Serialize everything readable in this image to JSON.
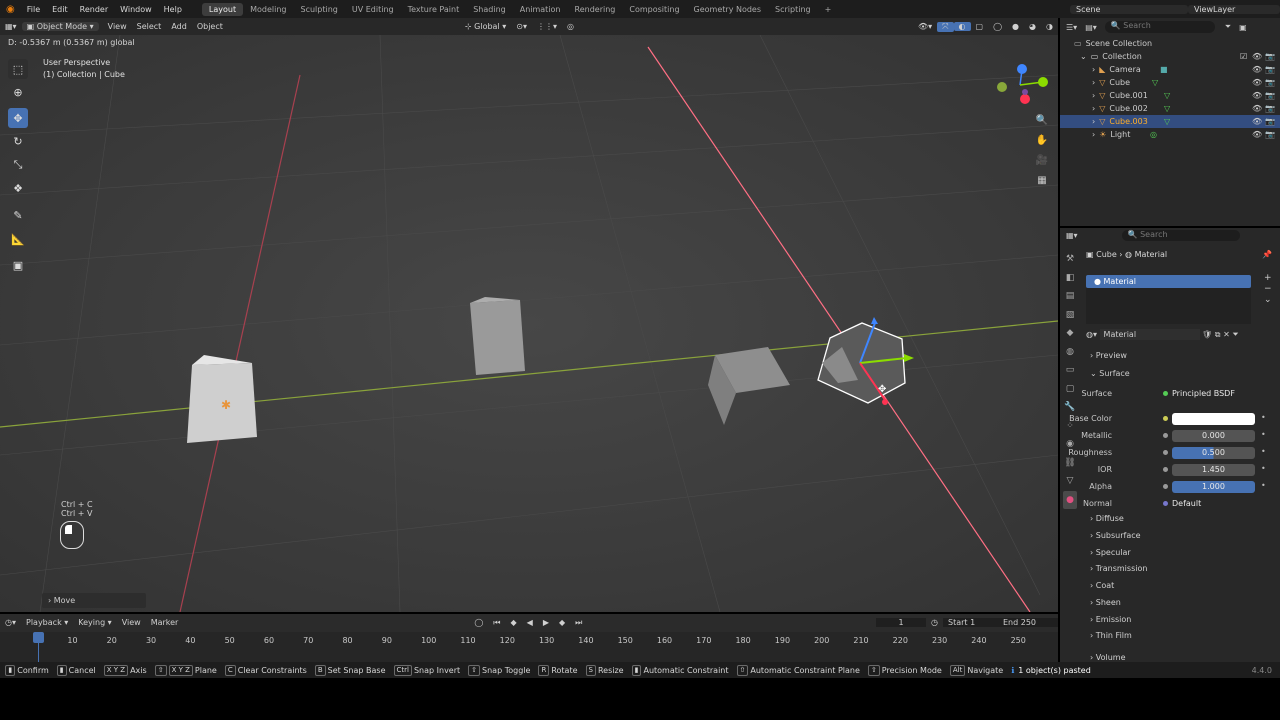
{
  "topbar": {
    "menus": [
      "File",
      "Edit",
      "Render",
      "Window",
      "Help"
    ],
    "workspaces": [
      "Layout",
      "Modeling",
      "Sculpting",
      "UV Editing",
      "Texture Paint",
      "Shading",
      "Animation",
      "Rendering",
      "Compositing",
      "Geometry Nodes",
      "Scripting"
    ],
    "scene": "Scene",
    "view_layer": "ViewLayer"
  },
  "vpheader": {
    "mode": "Object Mode",
    "menus": [
      "View",
      "Select",
      "Add",
      "Object"
    ],
    "orientation": "Global"
  },
  "viewport": {
    "status": "D: -0.5367 m (0.5367 m) global",
    "perspective": "User Perspective",
    "collection": "(1) Collection | Cube",
    "shortcut1": "Ctrl + C",
    "shortcut2": "Ctrl + V",
    "operator_panel": "Move"
  },
  "outliner": {
    "search_placeholder": "Search",
    "root": "Scene Collection",
    "collection": "Collection",
    "items": [
      {
        "name": "Camera"
      },
      {
        "name": "Cube"
      },
      {
        "name": "Cube.001"
      },
      {
        "name": "Cube.002"
      },
      {
        "name": "Cube.003"
      },
      {
        "name": "Light"
      }
    ]
  },
  "properties": {
    "search_placeholder": "Search",
    "breadcrumb_object": "Cube",
    "breadcrumb_material": "Material",
    "slot_name": "Material",
    "material_name": "Material",
    "preview": "Preview",
    "surface_header": "Surface",
    "surface_label": "Surface",
    "surface_value": "Principled BSDF",
    "fields": [
      {
        "label": "Base Color",
        "value": ""
      },
      {
        "label": "Metallic",
        "value": "0.000"
      },
      {
        "label": "Roughness",
        "value": "0.500",
        "fill": 0.5
      },
      {
        "label": "IOR",
        "value": "1.450"
      },
      {
        "label": "Alpha",
        "value": "1.000",
        "fill": 1.0
      },
      {
        "label": "Normal",
        "value": "Default"
      }
    ],
    "sections": [
      "Diffuse",
      "Subsurface",
      "Specular",
      "Transmission",
      "Coat",
      "Sheen",
      "Emission",
      "Thin Film",
      "Volume"
    ]
  },
  "timeline": {
    "menus": [
      "Playback",
      "Keying",
      "View",
      "Marker"
    ],
    "current_frame": "1",
    "start_label": "Start",
    "start": "1",
    "end_label": "End",
    "end": "250",
    "ticks": [
      "1",
      "10",
      "20",
      "30",
      "40",
      "50",
      "60",
      "70",
      "80",
      "90",
      "100",
      "110",
      "120",
      "130",
      "140",
      "150",
      "160",
      "170",
      "180",
      "190",
      "200",
      "210",
      "220",
      "230",
      "240",
      "250"
    ]
  },
  "statusbar": {
    "items": [
      {
        "key": "",
        "label": "Confirm"
      },
      {
        "key": "",
        "label": "Cancel"
      },
      {
        "key": "X Y Z",
        "label": "Axis"
      },
      {
        "key": "X Y Z",
        "label": "Plane"
      },
      {
        "key": "C",
        "label": "Clear Constraints"
      },
      {
        "key": "B",
        "label": "Set Snap Base"
      },
      {
        "key": "Ctrl",
        "label": "Snap Invert"
      },
      {
        "key": "",
        "label": "Snap Toggle"
      },
      {
        "key": "R",
        "label": "Rotate"
      },
      {
        "key": "S",
        "label": "Resize"
      },
      {
        "key": "",
        "label": "Automatic Constraint"
      },
      {
        "key": "",
        "label": "Automatic Constraint Plane"
      },
      {
        "key": "",
        "label": "Precision Mode"
      },
      {
        "key": "Alt",
        "label": "Navigate"
      }
    ],
    "message": "1 object(s) pasted",
    "version": "4.4.0"
  },
  "colors": {
    "accent": "#4772b3",
    "selected_text": "#ffaf29",
    "x_axis": "#ff3352",
    "y_axis": "#8bdc00"
  }
}
